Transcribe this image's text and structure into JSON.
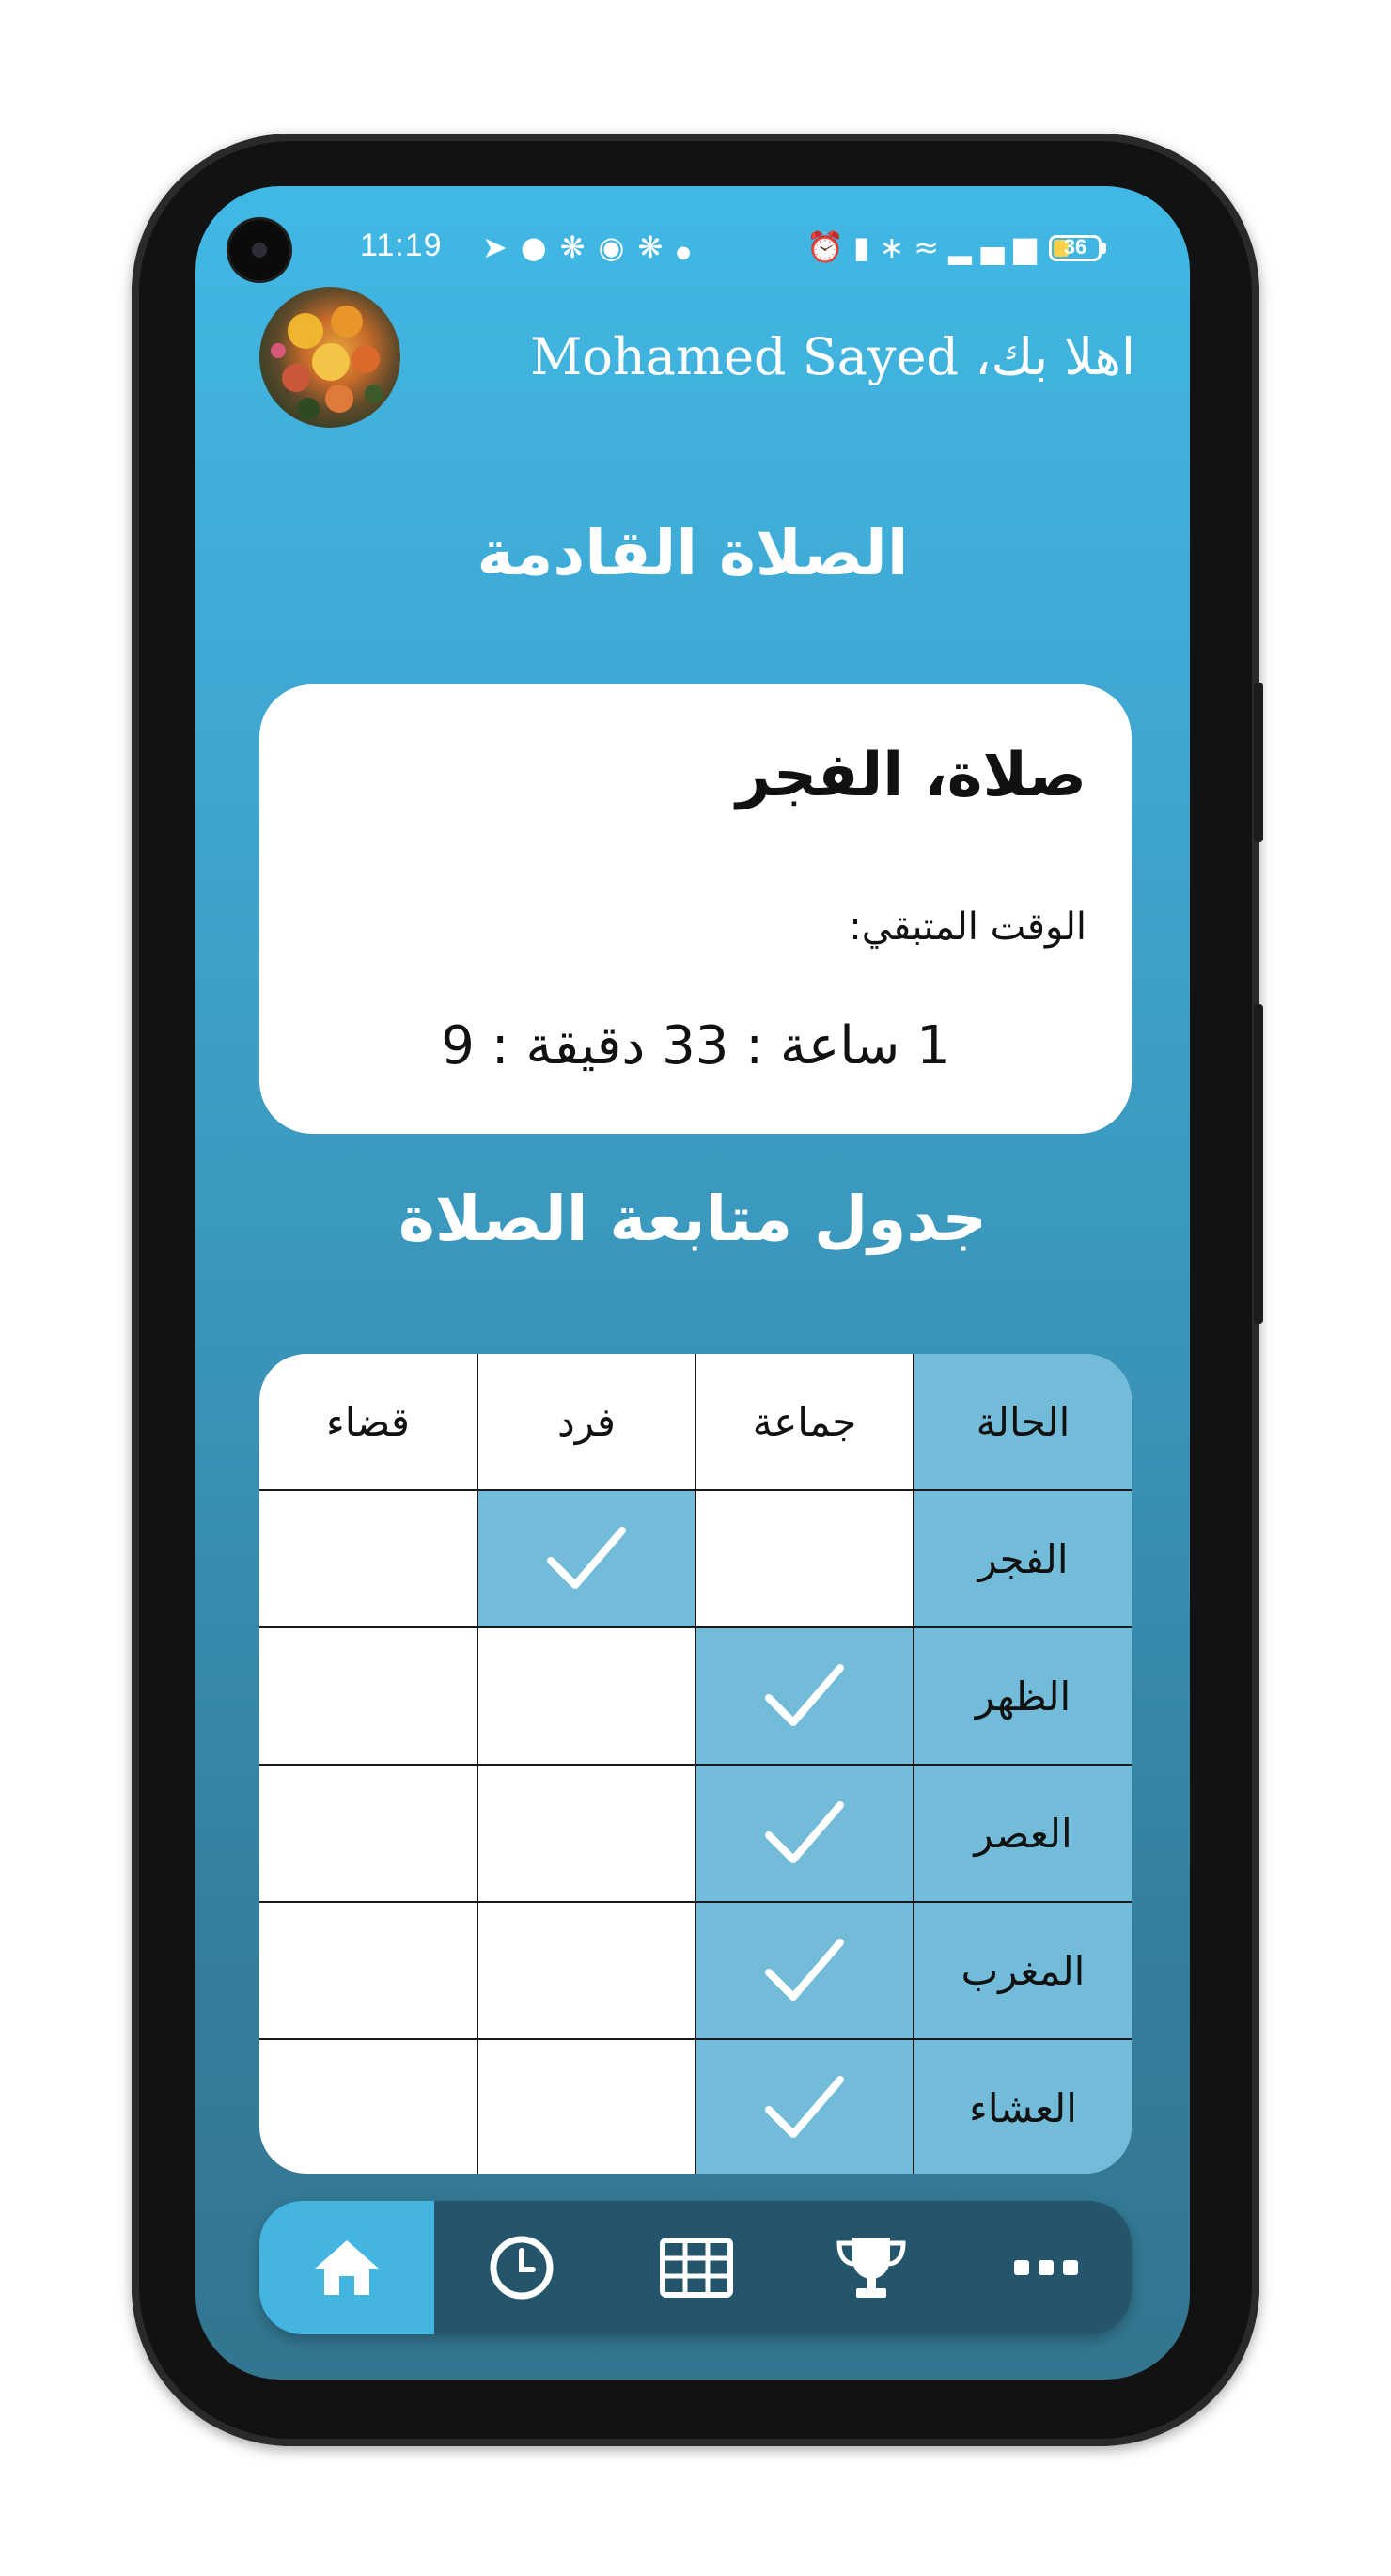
{
  "status_bar": {
    "time": "11:19",
    "left_icons": [
      "telegram-icon",
      "messenger-icon",
      "quran-icon",
      "facebook-icon",
      "quran-icon",
      "dot-icon"
    ],
    "right_icons": [
      "alarm-icon",
      "vibrate-icon",
      "bluetooth-icon",
      "wifi-icon",
      "signal-icon"
    ],
    "battery_level": "36"
  },
  "header": {
    "greeting": "اهلا بك، Mohamed Sayed",
    "avatar": "flower-photo"
  },
  "next_prayer": {
    "section_title": "الصلاة القادمة",
    "name": "صلاة، الفجر",
    "remaining_label": "الوقت المتبقي:",
    "countdown": "1 ساعة : 33 دقيقة : 9"
  },
  "tracker": {
    "section_title": "جدول متابعة الصلاة",
    "columns": [
      "الحالة",
      "جماعة",
      "فرد",
      "قضاء"
    ],
    "rows": [
      {
        "prayer": "الفجر",
        "jamaah": false,
        "fard": true,
        "qada": false
      },
      {
        "prayer": "الظهر",
        "jamaah": true,
        "fard": false,
        "qada": false
      },
      {
        "prayer": "العصر",
        "jamaah": true,
        "fard": false,
        "qada": false
      },
      {
        "prayer": "المغرب",
        "jamaah": true,
        "fard": false,
        "qada": false
      },
      {
        "prayer": "العشاء",
        "jamaah": true,
        "fard": false,
        "qada": false
      }
    ],
    "check_icon": "check-icon"
  },
  "bottom_nav": {
    "items": [
      {
        "icon": "home-icon",
        "active": true
      },
      {
        "icon": "clock-icon",
        "active": false
      },
      {
        "icon": "table-icon",
        "active": false
      },
      {
        "icon": "trophy-icon",
        "active": false
      },
      {
        "icon": "more-icon",
        "active": false
      }
    ]
  },
  "colors": {
    "background_top": "#41b8e4",
    "background_bottom": "#33758f",
    "highlight_cell": "#72bcd9",
    "nav_bar": "#24556b",
    "nav_active": "#44b5e0"
  }
}
